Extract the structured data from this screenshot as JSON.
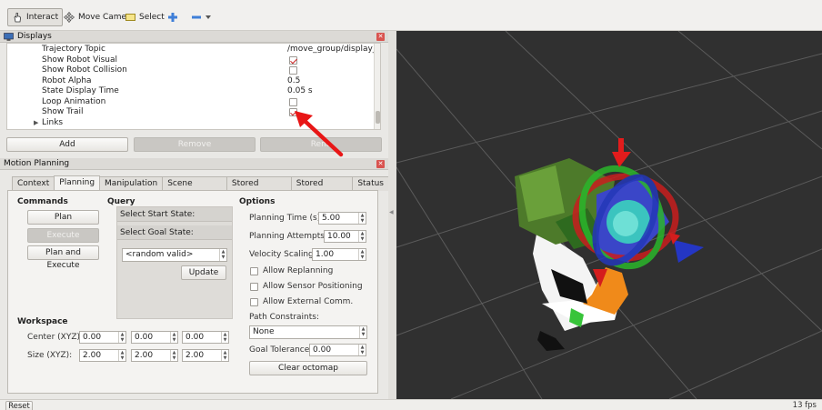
{
  "toolbar": {
    "interact": "Interact",
    "move_camera": "Move Camera",
    "select": "Select"
  },
  "displays": {
    "title": "Displays",
    "rows": [
      {
        "label": "Trajectory Topic",
        "value": "/move_group/display_..."
      },
      {
        "label": "Show Robot Visual",
        "checked": true
      },
      {
        "label": "Show Robot Collision",
        "checked": false
      },
      {
        "label": "Robot Alpha",
        "value": "0.5"
      },
      {
        "label": "State Display Time",
        "value": "0.05 s"
      },
      {
        "label": "Loop Animation",
        "checked": false
      },
      {
        "label": "Show Trail",
        "checked": true
      },
      {
        "label": "Links"
      }
    ],
    "add": "Add",
    "remove": "Remove",
    "rename": "Rena"
  },
  "motion_planning": {
    "title": "Motion Planning",
    "tabs": [
      "Context",
      "Planning",
      "Manipulation",
      "Scene Objects",
      "Stored Scenes",
      "Stored States",
      "Status"
    ],
    "commands": {
      "heading": "Commands",
      "plan": "Plan",
      "execute": "Execute",
      "plan_and_execute": "Plan and Execute"
    },
    "query": {
      "heading": "Query",
      "select_start": "Select Start State:",
      "select_goal": "Select Goal State:",
      "goal_option": "<random valid>",
      "update": "Update"
    },
    "options": {
      "heading": "Options",
      "planning_time_label": "Planning Time (s):",
      "planning_time": "5.00",
      "planning_attempts_label": "Planning Attempts:",
      "planning_attempts": "10.00",
      "velocity_scaling_label": "Velocity Scaling:",
      "velocity_scaling": "1.00",
      "allow_replanning": "Allow Replanning",
      "allow_sensor_positioning": "Allow Sensor Positioning",
      "allow_external_comm": "Allow External Comm.",
      "path_constraints_label": "Path Constraints:",
      "path_constraints": "None",
      "goal_tolerance_label": "Goal Tolerance:",
      "goal_tolerance": "0.00",
      "clear_octomap": "Clear octomap"
    },
    "workspace": {
      "heading": "Workspace",
      "center_label": "Center (XYZ):",
      "center": [
        "0.00",
        "0.00",
        "0.00"
      ],
      "size_label": "Size (XYZ):",
      "size": [
        "2.00",
        "2.00",
        "2.00"
      ]
    }
  },
  "bottom": {
    "reset": "Reset",
    "fps": "13 fps"
  },
  "colors": {
    "viewport_bg": "#303030",
    "annotation_arrow": "#e81616",
    "check_mark": "#cc2222"
  }
}
